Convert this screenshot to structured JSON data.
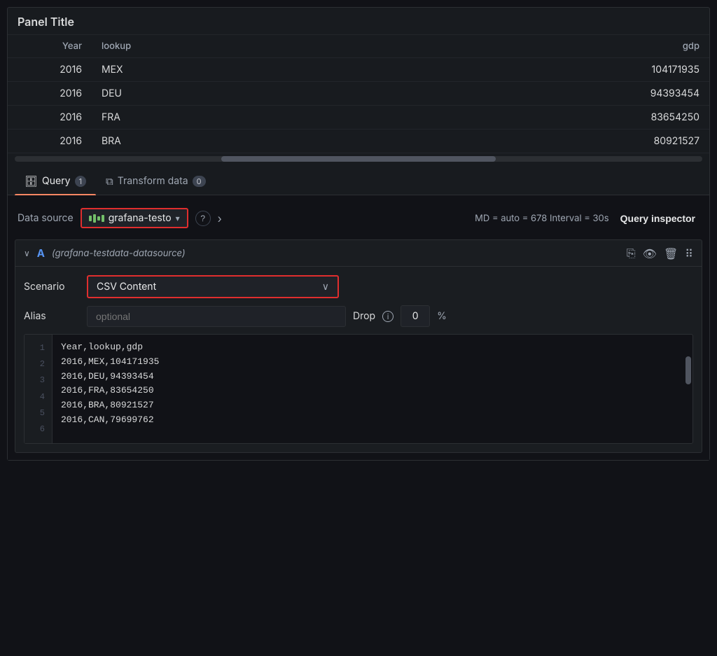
{
  "panel": {
    "title": "Panel Title",
    "table": {
      "columns": [
        "Year",
        "lookup",
        "gdp"
      ],
      "rows": [
        [
          "2016",
          "MEX",
          "104171935"
        ],
        [
          "2016",
          "DEU",
          "94393454"
        ],
        [
          "2016",
          "FRA",
          "83654250"
        ],
        [
          "2016",
          "BRA",
          "80921527"
        ]
      ]
    }
  },
  "tabs": [
    {
      "id": "query",
      "icon": "database",
      "label": "Query",
      "badge": "1",
      "active": true
    },
    {
      "id": "transform",
      "icon": "transform",
      "label": "Transform data",
      "badge": "0",
      "active": false
    }
  ],
  "datasource": {
    "label": "Data source",
    "name": "grafana-testo",
    "meta_label": "MD = auto = 678   Interval = 30s",
    "help_tooltip": "?",
    "inspector_label": "Query inspector"
  },
  "query_block": {
    "letter": "A",
    "ds_name": "(grafana-testdata-datasource)",
    "scenario": {
      "label": "Scenario",
      "value": "CSV Content"
    },
    "alias": {
      "label": "Alias",
      "placeholder": "optional"
    },
    "drop": {
      "label": "Drop",
      "value": "0",
      "unit": "%"
    },
    "csv_lines": [
      {
        "num": "1",
        "text": "Year,lookup,gdp"
      },
      {
        "num": "2",
        "text": "2016,MEX,104171935"
      },
      {
        "num": "3",
        "text": "2016,DEU,94393454"
      },
      {
        "num": "4",
        "text": "2016,FRA,83654250"
      },
      {
        "num": "5",
        "text": "2016,BRA,80921527"
      },
      {
        "num": "6",
        "text": "2016,CAN,79699762"
      }
    ]
  }
}
